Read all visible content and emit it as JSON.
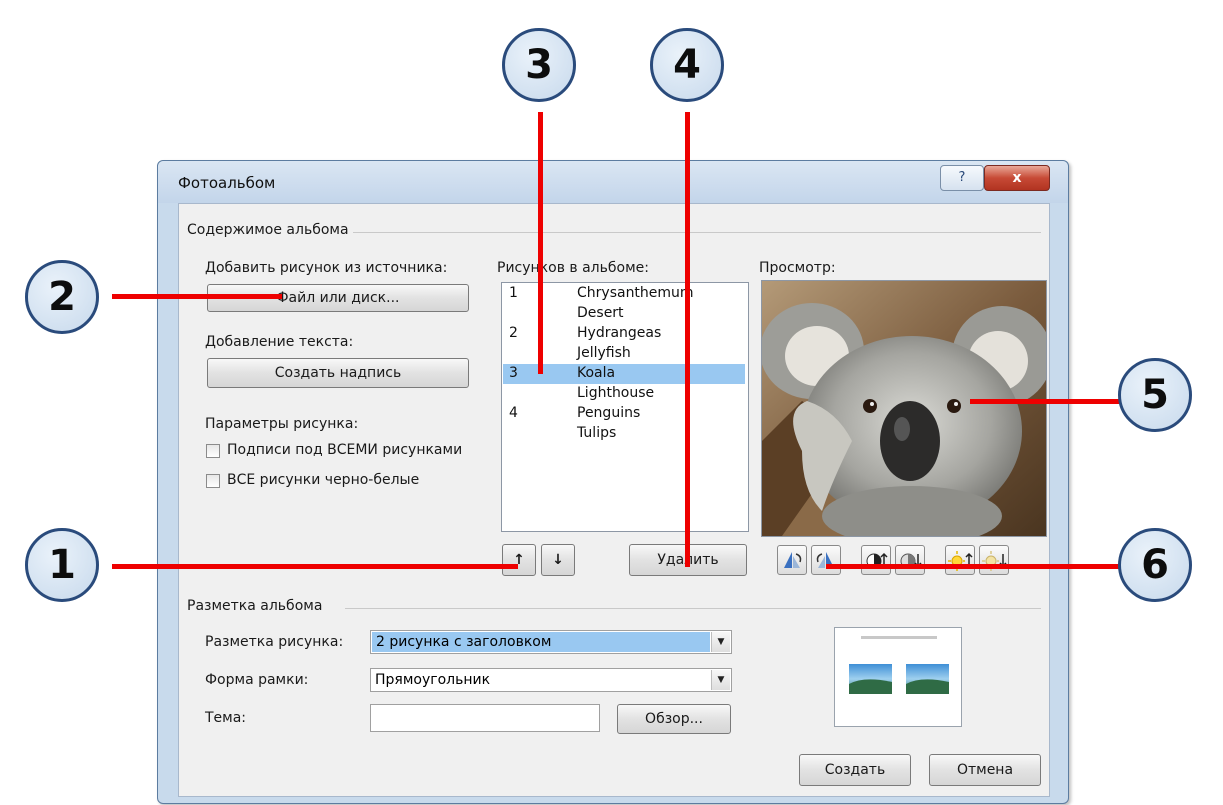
{
  "dialog": {
    "title": "Фотоальбом",
    "help_label": "?",
    "close_label": "x"
  },
  "content": {
    "group_title": "Содержимое альбома",
    "add_from_label": "Добавить рисунок из источника:",
    "file_button": "Файл или диск...",
    "add_text_label": "Добавление текста:",
    "textbox_button": "Создать надпись",
    "picture_options_label": "Параметры рисунка:",
    "captions_checkbox": "Подписи под ВСЕМИ рисунками",
    "bw_checkbox": "ВСЕ рисунки черно-белые",
    "pictures_label": "Рисунков в альбоме:",
    "list": [
      {
        "num": "1",
        "name": "Chrysanthemum"
      },
      {
        "num": "",
        "name": "Desert"
      },
      {
        "num": "2",
        "name": "Hydrangeas"
      },
      {
        "num": "",
        "name": "Jellyfish"
      },
      {
        "num": "3",
        "name": "Koala"
      },
      {
        "num": "",
        "name": "Lighthouse"
      },
      {
        "num": "4",
        "name": "Penguins"
      },
      {
        "num": "",
        "name": "Tulips"
      }
    ],
    "selected_index": 4,
    "move_up_label": "↑",
    "move_down_label": "↓",
    "remove_button": "Удалить",
    "preview_label": "Просмотр:"
  },
  "layout": {
    "group_title": "Разметка альбома",
    "picture_layout_label": "Разметка рисунка:",
    "picture_layout_value": "2 рисунка с заголовком",
    "frame_shape_label": "Форма рамки:",
    "frame_shape_value": "Прямоугольник",
    "theme_label": "Тема:",
    "theme_value": "",
    "browse_button": "Обзор...",
    "create_button": "Создать",
    "cancel_button": "Отмена"
  },
  "callouts": [
    "1",
    "2",
    "3",
    "4",
    "5",
    "6"
  ],
  "colors": {
    "callout_line": "#ee0000",
    "selection": "#99c8f1",
    "layout_highlight": "#99c8f1"
  },
  "icons": [
    "rotate-left-icon",
    "rotate-right-icon",
    "contrast-up-icon",
    "contrast-down-icon",
    "brightness-up-icon",
    "brightness-down-icon",
    "chevron-down-icon"
  ]
}
